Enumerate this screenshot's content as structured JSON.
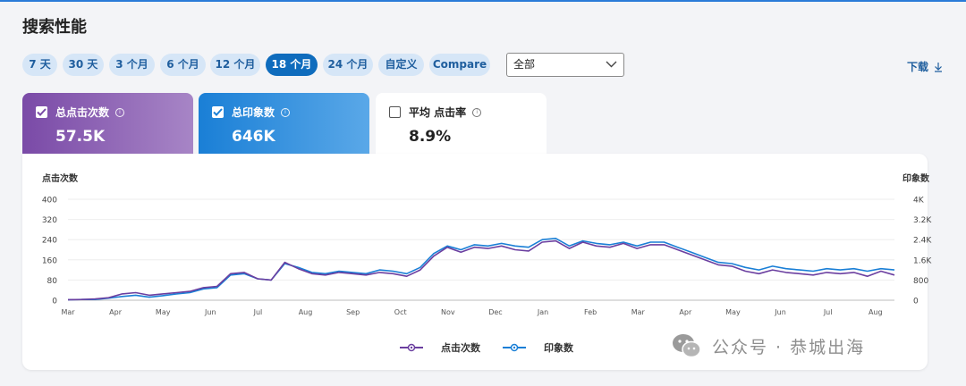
{
  "page": {
    "title": "搜索性能"
  },
  "ranges": [
    "7 天",
    "30 天",
    "3 个月",
    "6 个月",
    "12 个月",
    "18 个月",
    "24 个月",
    "自定义",
    "Compare"
  ],
  "active_range_index": 5,
  "filter": {
    "value": "全部"
  },
  "download_label": "下载",
  "cards": [
    {
      "label": "总点击次数",
      "value": "57.5K",
      "checked": true
    },
    {
      "label": "总印象数",
      "value": "646K",
      "checked": true
    },
    {
      "label": "平均 点击率",
      "value": "8.9%",
      "checked": false
    }
  ],
  "colors": {
    "clicks": "#6b3fa0",
    "impressions": "#1a7fd6",
    "active": "#0f6cbd"
  },
  "chart_data": {
    "type": "line",
    "x_labels": [
      "Mar",
      "Apr",
      "May",
      "Jun",
      "Jul",
      "Aug",
      "Sep",
      "Oct",
      "Nov",
      "Dec",
      "Jan",
      "Feb",
      "Mar",
      "Apr",
      "May",
      "Jun",
      "Jul",
      "Aug"
    ],
    "left_axis": {
      "title": "点击次数",
      "ticks": [
        "400",
        "320",
        "240",
        "160",
        "80",
        "0"
      ],
      "range": [
        0,
        400
      ]
    },
    "right_axis": {
      "title": "印象数",
      "ticks": [
        "4K",
        "3.2K",
        "2.4K",
        "1.6K",
        "800",
        "0"
      ],
      "range": [
        0,
        4000
      ]
    },
    "series": [
      {
        "name": "点击次数",
        "axis": "left",
        "values": [
          2,
          3,
          5,
          10,
          25,
          30,
          20,
          25,
          30,
          35,
          50,
          55,
          105,
          110,
          85,
          80,
          150,
          125,
          105,
          100,
          110,
          105,
          100,
          110,
          105,
          95,
          120,
          175,
          210,
          190,
          210,
          205,
          215,
          200,
          195,
          230,
          235,
          205,
          230,
          215,
          210,
          225,
          205,
          220,
          220,
          200,
          180,
          160,
          140,
          135,
          115,
          105,
          120,
          110,
          105,
          100,
          110,
          105,
          110,
          95,
          115,
          100
        ]
      },
      {
        "name": "印象数",
        "axis": "left",
        "values": [
          2,
          3,
          3,
          8,
          15,
          20,
          12,
          18,
          25,
          30,
          45,
          50,
          100,
          105,
          85,
          80,
          145,
          130,
          110,
          105,
          115,
          110,
          105,
          120,
          115,
          105,
          130,
          185,
          215,
          200,
          220,
          215,
          225,
          215,
          210,
          240,
          245,
          215,
          235,
          225,
          220,
          230,
          215,
          230,
          230,
          210,
          190,
          170,
          150,
          145,
          130,
          120,
          135,
          125,
          120,
          115,
          125,
          120,
          125,
          115,
          125,
          120
        ]
      }
    ]
  },
  "watermark": {
    "text": "公众号 · 恭城出海"
  }
}
